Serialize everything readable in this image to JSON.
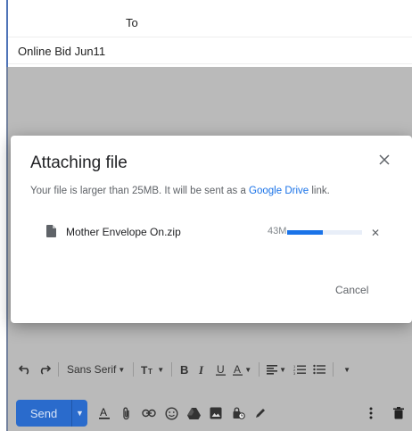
{
  "compose": {
    "to_label": "To",
    "subject": "Online Bid Jun11"
  },
  "dialog": {
    "title": "Attaching file",
    "message": "Your file is larger than 25MB. It will be sent as a ",
    "link_text": "Google Drive",
    "message_end": " link.",
    "file": {
      "name": "Mother Envelope On.zip",
      "size": "43M",
      "progress": 0.48
    },
    "cancel_label": "Cancel"
  },
  "toolbar": {
    "font_label": "Sans Serif"
  },
  "actions": {
    "send_label": "Send"
  },
  "colors": {
    "accent": "#1a73e8",
    "send_button": "#2a6bcc",
    "compose_border": "#4f74b8"
  }
}
